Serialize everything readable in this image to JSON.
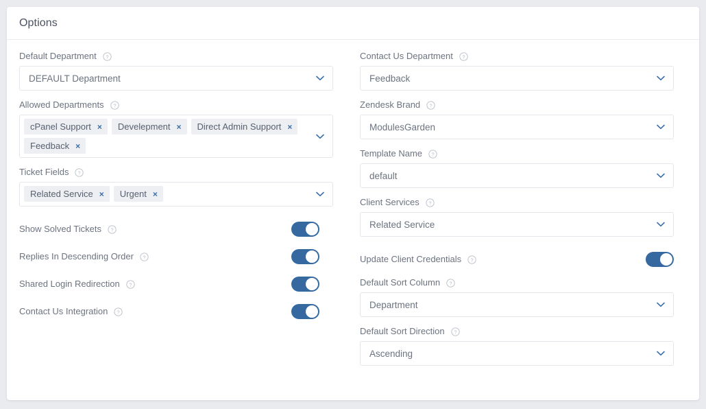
{
  "card": {
    "title": "Options"
  },
  "icons": {
    "help": "help-circle-icon",
    "chevron": "chevron-down-icon",
    "remove": "×"
  },
  "colors": {
    "page_background": "#eaebef",
    "card_background": "#ffffff",
    "toggle_on": "#36699f",
    "tag_background": "#edeff2",
    "tag_remove": "#3a6ea8",
    "label_text": "#6c737f",
    "title_text": "#4a5160",
    "border": "#e3e6ea"
  },
  "left_column": {
    "default_department": {
      "label": "Default Department",
      "value": "DEFAULT Department"
    },
    "allowed_departments": {
      "label": "Allowed Departments",
      "tags": [
        "cPanel Support",
        "Develepment",
        "Direct Admin Support",
        "Feedback"
      ]
    },
    "ticket_fields": {
      "label": "Ticket Fields",
      "tags": [
        "Related Service",
        "Urgent"
      ]
    },
    "toggles": [
      {
        "label": "Show Solved Tickets",
        "on": true
      },
      {
        "label": "Replies In Descending Order",
        "on": true
      },
      {
        "label": "Shared Login Redirection",
        "on": true
      },
      {
        "label": "Contact Us Integration",
        "on": true
      }
    ]
  },
  "right_column": {
    "contact_us_department": {
      "label": "Contact Us Department",
      "value": "Feedback"
    },
    "zendesk_brand": {
      "label": "Zendesk Brand",
      "value": "ModulesGarden"
    },
    "template_name": {
      "label": "Template Name",
      "value": "default"
    },
    "client_services": {
      "label": "Client Services",
      "value": "Related Service"
    },
    "update_client_credentials": {
      "label": "Update Client Credentials",
      "on": true
    },
    "default_sort_column": {
      "label": "Default Sort Column",
      "value": "Department"
    },
    "default_sort_direction": {
      "label": "Default Sort Direction",
      "value": "Ascending"
    }
  }
}
